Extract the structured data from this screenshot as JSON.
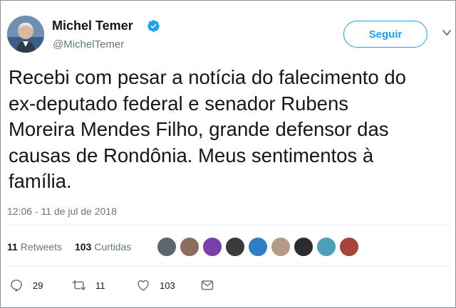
{
  "author": {
    "name": "Michel Temer",
    "handle": "@MichelTemer",
    "verified": true
  },
  "follow_button": {
    "label": "Seguir"
  },
  "tweet": {
    "text": "Recebi com pesar a notícia do falecimento do\nex-deputado federal e senador Rubens\nMoreira Mendes Filho, grande defensor das\ncausas de Rondônia. Meus sentimentos à\nfamília.",
    "timestamp": "12:06 - 11 de jul de 2018"
  },
  "stats": {
    "retweets_count": "11",
    "retweets_label": "Retweets",
    "likes_count": "103",
    "likes_label": "Curtidas"
  },
  "liked_by_avatars": [
    {
      "color": "#5b6770"
    },
    {
      "color": "#8a6d5a"
    },
    {
      "color": "#7a3fa8"
    },
    {
      "color": "#3a3a3a"
    },
    {
      "color": "#2d7fc4"
    },
    {
      "color": "#b59a86"
    },
    {
      "color": "#2c2c2c"
    },
    {
      "color": "#4aa0b8"
    },
    {
      "color": "#a8433a"
    }
  ],
  "actions": {
    "reply_count": "29",
    "retweet_count": "11",
    "like_count": "103"
  },
  "colors": {
    "accent": "#1da1f2",
    "muted": "#657786",
    "text": "#14171a"
  }
}
